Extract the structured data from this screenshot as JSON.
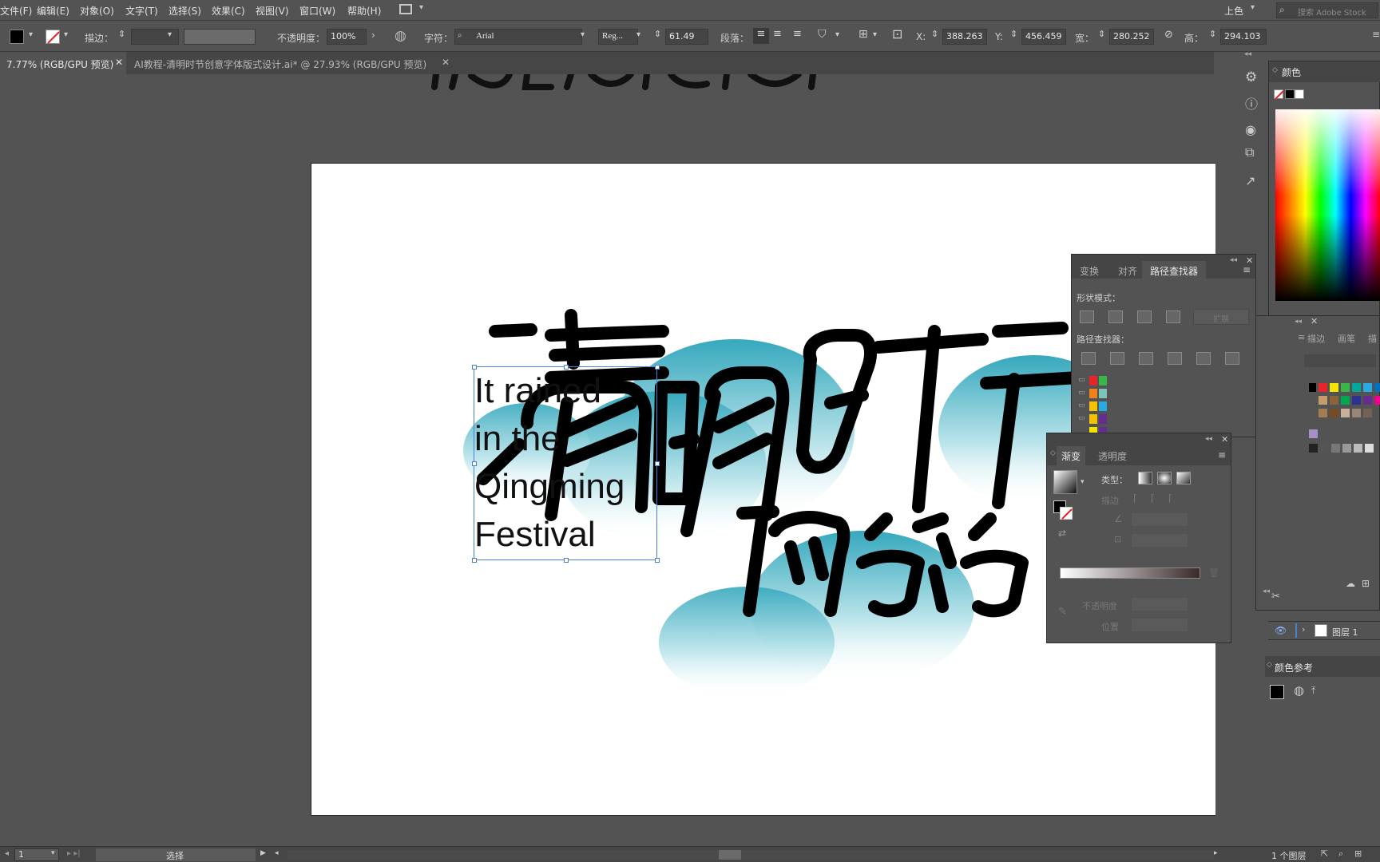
{
  "menu": {
    "file": "文件(F)",
    "edit": "编辑(E)",
    "object": "对象(O)",
    "type": "文字(T)",
    "select": "选择(S)",
    "effect": "效果(C)",
    "view": "视图(V)",
    "window": "窗口(W)",
    "help": "帮助(H)",
    "workspace": "上色",
    "search_placeholder": "搜索 Adobe Stock"
  },
  "control": {
    "stroke_label": "描边：",
    "opacity_label": "不透明度：",
    "opacity_value": "100%",
    "char_label": "字符：",
    "font_name": "Arial",
    "font_style": "Reg...",
    "font_size": "61.49",
    "para_label": "段落：",
    "x_label": "X:",
    "x_value": "388.263",
    "y_label": "Y:",
    "y_value": "456.459",
    "w_label": "宽：",
    "w_value": "280.252",
    "h_label": "高：",
    "h_value": "294.103",
    "unit_suffix": "1"
  },
  "tabs": [
    {
      "label": "7.77% (RGB/GPU 预览)",
      "active": true
    },
    {
      "label": "AI教程-清明时节创意字体版式设计.ai* @ 27.93% (RGB/GPU 预览)",
      "active": false
    }
  ],
  "canvas": {
    "text_lines": [
      "It rained",
      "in the",
      "Qingming",
      "Festival"
    ],
    "title_chars": "清明时节",
    "subtitle_chars": "雨纷纷"
  },
  "pathfinder_panel": {
    "tab_transform": "变换",
    "tab_align": "对齐",
    "tab_pathfinder": "路径查找器",
    "shape_modes": "形状模式：",
    "expand": "扩展",
    "pathfinders": "路径查找器："
  },
  "gradient_panel": {
    "tab_gradient": "渐变",
    "tab_transparency": "透明度",
    "type_label": "类型：",
    "stroke_label": "描边",
    "opacity_label": "不透明度",
    "position_label": "位置"
  },
  "color_panel": {
    "title": "颜色"
  },
  "layers_panel": {
    "layer_name": "图层 1",
    "count": "1 个图层"
  },
  "color_guide": {
    "title": "颜色参考"
  },
  "brushes_tabs": {
    "brushes": "画笔",
    "symbols": "描边"
  },
  "status": {
    "page": "1",
    "tool": "选择"
  },
  "swatch_colors": [
    "#e8242a",
    "#f5e300",
    "#39b54a",
    "#00a99d",
    "#29abe2",
    "#0071bc",
    "#662d91",
    "#ec008c"
  ],
  "folder_colors": [
    "#e8242a",
    "#39b54a",
    "#f08019",
    "#7ac4b8",
    "#f5c200",
    "#29abe2",
    "#f5c200",
    "#662d91",
    "#f5e300",
    "#662d91"
  ],
  "accent": "#3a9fc0"
}
